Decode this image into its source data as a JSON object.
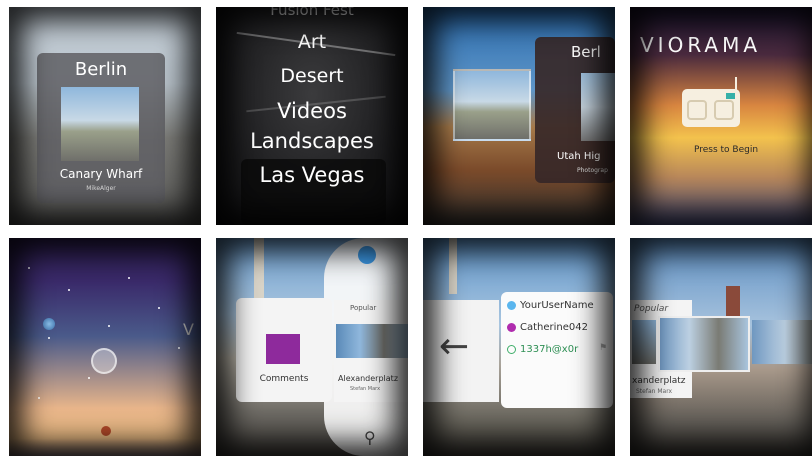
{
  "tile1": {
    "title": "Berlin",
    "subtitle": "Canary Wharf",
    "author": "MikeAlger"
  },
  "tile2": {
    "menu_partial": "Fusion Fest",
    "menu": [
      "Art",
      "Desert",
      "Videos",
      "Landscapes",
      "Las Vegas"
    ]
  },
  "tile3": {
    "title": "Berl",
    "subtitle": "Utah Hig",
    "author": "Photograp"
  },
  "tile4": {
    "logo": "VIORAMA",
    "press": "Press to Begin"
  },
  "tile5": {
    "letter": "V"
  },
  "tile6": {
    "comments": "Comments",
    "popular": "Popular",
    "place": "Alexanderplatz",
    "author": "Stefan Marx"
  },
  "tile7": {
    "users": [
      {
        "name": "YourUserName",
        "color": "#5bb6ee"
      },
      {
        "name": "Catherine042",
        "color": "#b02cae"
      },
      {
        "name": "1337h@x0r",
        "color": "#3fae6a"
      }
    ]
  },
  "tile8": {
    "popular": "Popular",
    "place": "xanderplatz",
    "author": "Stefan Marx"
  }
}
